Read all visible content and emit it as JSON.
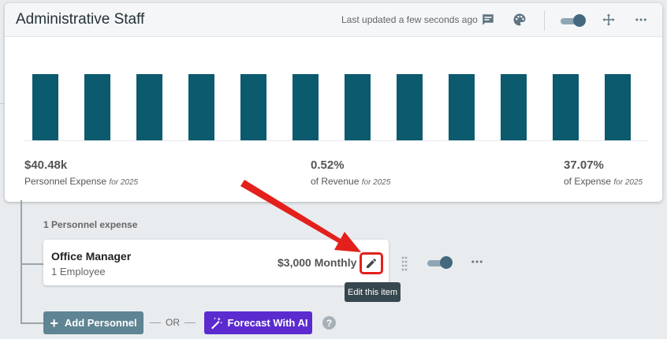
{
  "card": {
    "title": "Administrative Staff",
    "last_updated": "Last updated a few seconds ago"
  },
  "chart_data": {
    "type": "bar",
    "categories": [
      "",
      "",
      "",
      "",
      "",
      "",
      "",
      "",
      "",
      "",
      "",
      ""
    ],
    "values": [
      3373,
      3373,
      3373,
      3373,
      3373,
      3373,
      3373,
      3373,
      3373,
      3373,
      3373,
      3373
    ],
    "title": "",
    "xlabel": "",
    "ylabel": "",
    "ylim": [
      0,
      3373
    ],
    "grid": false,
    "color": "#0b5a6e"
  },
  "stats": [
    {
      "value": "$40.48k",
      "label": "Personnel Expense",
      "period": "for 2025"
    },
    {
      "value": "0.52%",
      "label": "of Revenue",
      "period": "for 2025"
    },
    {
      "value": "37.07%",
      "label": "of Expense",
      "period": "for 2025"
    }
  ],
  "personnel": {
    "section_label": "1 Personnel expense",
    "item": {
      "name": "Office Manager",
      "sub": "1 Employee",
      "amount": "$3,000 Monthly"
    },
    "tooltip": "Edit this item",
    "add_label": "Add Personnel",
    "or_label": "OR",
    "ai_label": "Forecast With AI",
    "help": "?"
  },
  "colors": {
    "bar": "#0b5a6e",
    "ai_button": "#5b2bd0",
    "add_button": "#5f8493",
    "highlight": "#e3201b"
  }
}
